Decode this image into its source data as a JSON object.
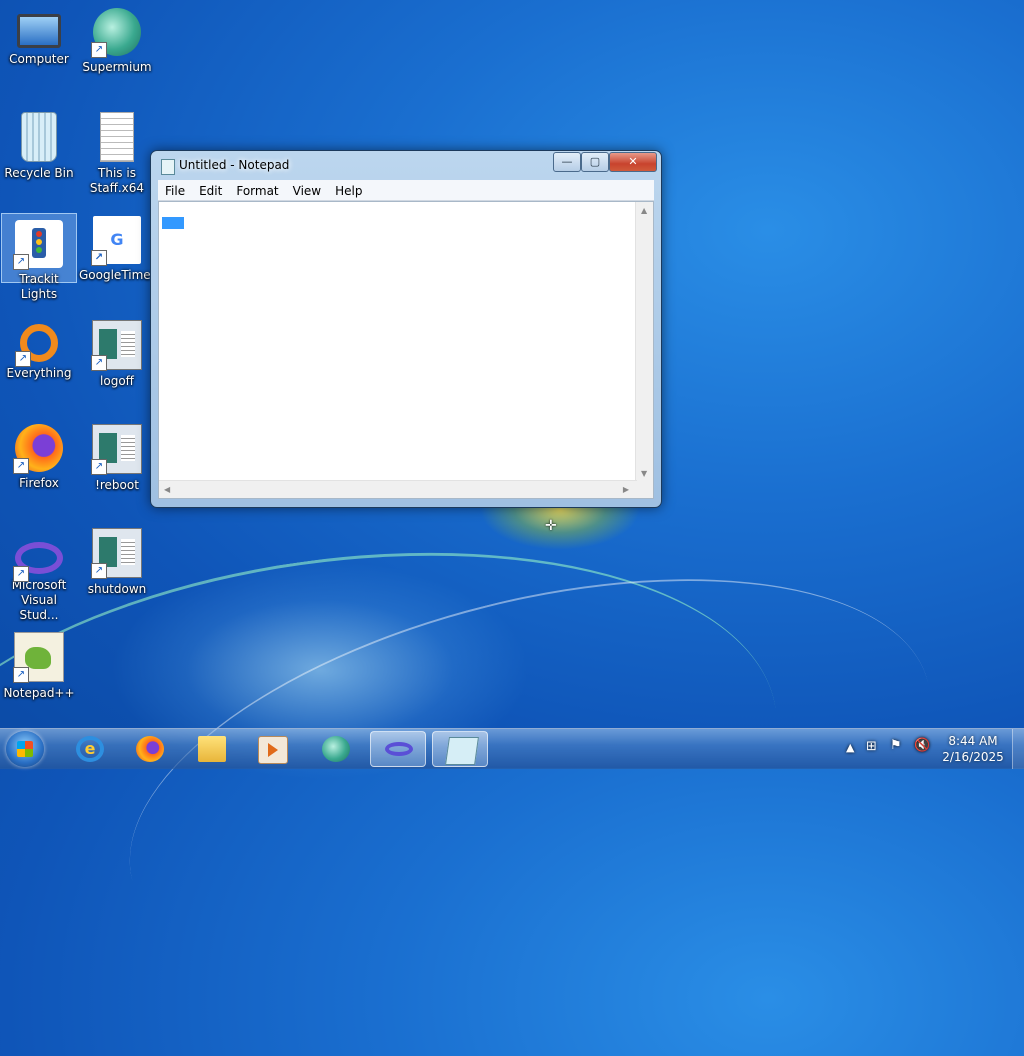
{
  "desktop": {
    "icons": [
      {
        "label": "Computer",
        "icon": "computer-icon"
      },
      {
        "label": "Supermium",
        "icon": "supermium-icon"
      },
      {
        "label": "Recycle Bin",
        "icon": "recycle-bin-icon"
      },
      {
        "label": "This is Staff.x64",
        "icon": "document-icon"
      },
      {
        "label": "Trackit Lights",
        "icon": "traffic-light-icon"
      },
      {
        "label": "GoogleTimer",
        "icon": "google-icon"
      },
      {
        "label": "Everything",
        "icon": "everything-search-icon"
      },
      {
        "label": "logoff",
        "icon": "shortcut-window-icon"
      },
      {
        "label": "Firefox",
        "icon": "firefox-icon"
      },
      {
        "label": "!reboot",
        "icon": "shortcut-window-icon"
      },
      {
        "label": "Microsoft Visual Stud...",
        "icon": "visual-studio-icon"
      },
      {
        "label": "shutdown",
        "icon": "shortcut-window-icon"
      },
      {
        "label": "Notepad++",
        "icon": "notepadpp-icon"
      }
    ]
  },
  "notepad": {
    "title": "Untitled - Notepad",
    "controls": {
      "minimize": "—",
      "maximize": "▢",
      "close": "✕"
    },
    "menu": [
      "File",
      "Edit",
      "Format",
      "View",
      "Help"
    ],
    "content": ""
  },
  "taskbar": {
    "pinned": [
      {
        "name": "Internet Explorer",
        "icon": "internet-explorer-icon"
      },
      {
        "name": "Firefox",
        "icon": "firefox-icon"
      },
      {
        "name": "Windows Explorer",
        "icon": "folder-icon"
      },
      {
        "name": "Media Player",
        "icon": "media-player-icon"
      },
      {
        "name": "Supermium",
        "icon": "supermium-icon"
      },
      {
        "name": "Visual Studio",
        "icon": "visual-studio-icon",
        "active": true
      },
      {
        "name": "Notepad",
        "icon": "notepad-icon",
        "active": true
      }
    ],
    "tray": {
      "time": "8:44 AM",
      "date": "2/16/2025"
    }
  }
}
